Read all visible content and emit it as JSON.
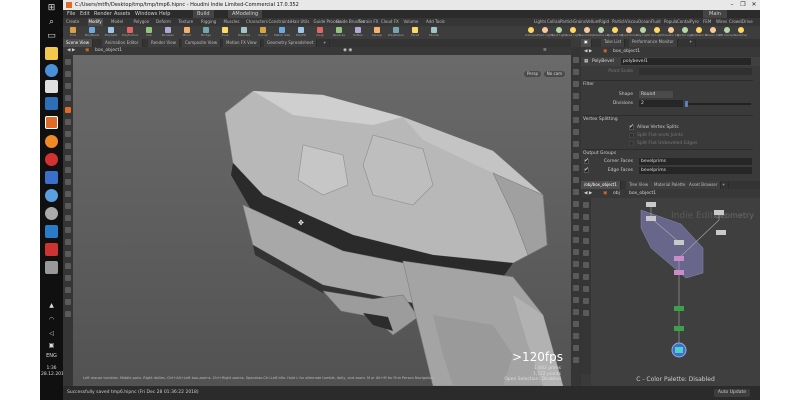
{
  "window": {
    "title": "C:/Users/mtfh/Desktop/tmp/tmp/tmp6.hipnc - Houdini Indie Limited-Commercial 17.0.352",
    "controls": [
      "–",
      "❐",
      "✕"
    ]
  },
  "taskbar": {
    "icons": [
      "windows-start",
      "search",
      "task-view",
      "file-explorer",
      "chrome",
      "firefox",
      "store",
      "houdini",
      "app-orange",
      "app-red",
      "app-blue",
      "app-globe",
      "app-gear",
      "app-blue-2",
      "app-shield",
      "app-red-2",
      "app-gray"
    ],
    "language": "ENG",
    "time": "1:36",
    "date": "28.12.2018"
  },
  "menubar": {
    "items": [
      "File",
      "Edit",
      "Render",
      "Assets",
      "Windows",
      "Help"
    ],
    "build_label": "Build",
    "desktop_label": "AModeling",
    "main_label": "Main"
  },
  "shelf": {
    "tabs": [
      "Create",
      "Modify",
      "Model",
      "Polygon",
      "Deform",
      "Texture",
      "Rigging",
      "Muscles",
      "Characters",
      "Constraints",
      "Hair Utils",
      "Guide Process",
      "Guide Brushes",
      "Terrain FX",
      "Cloud FX",
      "Volume",
      "Add Tools"
    ],
    "active_tab": "Modify",
    "right_tabs": [
      "Lights and Cameras",
      "Collisions",
      "Particles",
      "Grains",
      "Vellum",
      "Rigid Bodies",
      "Particle Fluids",
      "Viscous Fluids",
      "Oceans",
      "Fluid Containers",
      "Populate Containers",
      "Container Tools",
      "Pyro FX",
      "FEM",
      "Wires",
      "Crowds",
      "Drive Simulation"
    ],
    "tools": [
      "Edit",
      "PolyBevel",
      "PolySplit",
      "PolyExtrude",
      "Clip",
      "Boolean",
      "Mirror",
      "Bridge",
      "Fuse",
      "Dissolve",
      "Group",
      "Match Size",
      "PolyFill",
      "Cusp",
      "Reverse",
      "Soften",
      "Sweep",
      "PolyReduce",
      "Facet",
      "Divide"
    ],
    "right_tools": [
      "Camera",
      "Point Light",
      "Spot Light",
      "Area Light",
      "Geometry Light",
      "Volume Light",
      "Distant Light",
      "Environment Light",
      "Sky Light",
      "GI Light",
      "Caustic Light",
      "Portal Light",
      "Ambient Light",
      "Stereo Camera",
      "VR Camera",
      "Switcher"
    ]
  },
  "pane_tabs": [
    "Scene View",
    "Animation Editor",
    "Render View",
    "Composite View",
    "Motion FX View",
    "Geometry Spreadsheet"
  ],
  "viewport": {
    "header_label": "View",
    "path": "box_object1",
    "perspective_label": "Persp",
    "camera_label": "No cam",
    "fps": ">120fps",
    "stats": [
      "1,682 prims",
      "1,722 points"
    ],
    "selection_label": "Open Selection: Disabled",
    "status_hint": "Left mouse tumbles. Middle pans. Right dollies. Ctrl+Alt+Left box-zooms. Ctrl+Right zooms. Spacebar-Ctrl-Left tilts. Hold L for alternate tumble, dolly, and zoom.    M or Alt+M for First Person Navigation."
  },
  "param_pane": {
    "tabs": [
      "Take List",
      "Performance Monitor"
    ],
    "path": "box_object1",
    "node_type": "PolyBevel",
    "node_name": "polybevel1",
    "point_scale_label": "Point Scale",
    "filter_section": "Filter",
    "shape_label": "Shape",
    "shape_value": "Round",
    "divisions_label": "Divisions",
    "divisions_value": "2",
    "vertex_splitting_section": "Vertex Splitting",
    "allow_vertex_splits": "Allow Vertex Splits",
    "split_flat_edges": "Split Flat-ends Joints",
    "split_flat_unbevel": "Split Flat Unbeveled Edges",
    "output_groups_section": "Output Groups",
    "corner_faces_label": "Corner Faces",
    "corner_faces_value": "bevelprims",
    "edge_faces_label": "Edge Faces",
    "edge_faces_value": "bevelprims"
  },
  "network_pane": {
    "tabs": [
      "/obj/box_object1",
      "Tree View",
      "Material Palette",
      "Asset Browser"
    ],
    "path": "obj",
    "node_path": "box_object1",
    "watermark": "Indie Edition",
    "context_label": "Geometry",
    "footer": "C - Color Palette: Disabled"
  },
  "statusbar": {
    "message": "Successfully saved tmp6.hipnc (Fri Dec 28 01:36:22 2018)",
    "auto_update": "Auto Update"
  },
  "colors": {
    "houdini_orange": "#e06a28",
    "node_purple": "#8a86c8",
    "node_green": "#3aa34a",
    "node_blue": "#3d6fd0"
  }
}
